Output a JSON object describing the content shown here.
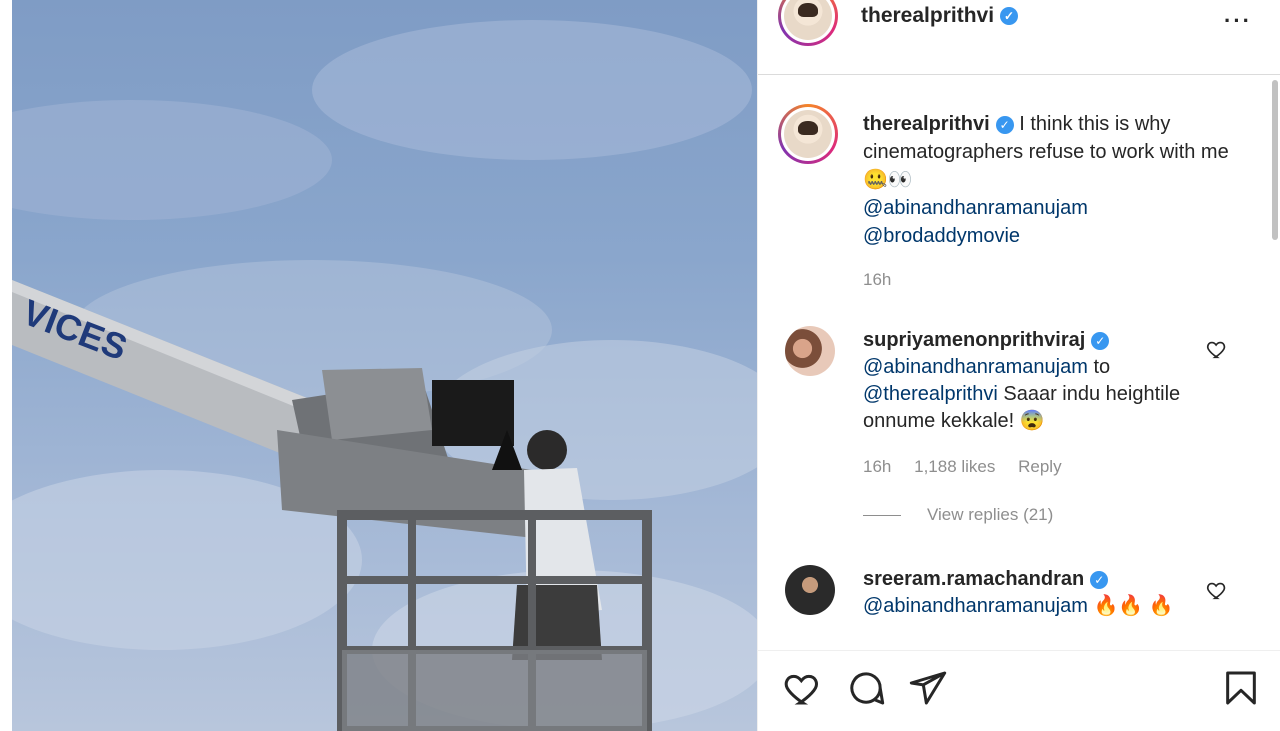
{
  "post": {
    "author": "therealprithvi",
    "caption": {
      "text": "I think this is why cinematographers refuse to work with me 🤐👀",
      "mentions": [
        "@abinandhanramanujam",
        "@brodaddymovie"
      ],
      "time": "16h"
    },
    "photo_text": "VICES"
  },
  "comments": [
    {
      "username": "supriyamenonprithviraj",
      "mention": "@abinandhanramanujam",
      "text_mid": "to",
      "mention2": "@therealprithvi",
      "text": "Saaar indu heightile onnume kekkale! 😨",
      "time": "16h",
      "likes": "1,188 likes",
      "reply_label": "Reply",
      "view_replies": "View replies (21)"
    },
    {
      "username": "sreeram.ramachandran",
      "mention": "@abinandhanramanujam",
      "text": "🔥🔥 🔥"
    }
  ],
  "actions": {
    "icons": [
      "heart-icon",
      "comment-icon",
      "share-icon",
      "bookmark-icon"
    ]
  },
  "colors": {
    "mention": "#00376b",
    "verified": "#3897f0",
    "meta": "#8e8e8e"
  }
}
